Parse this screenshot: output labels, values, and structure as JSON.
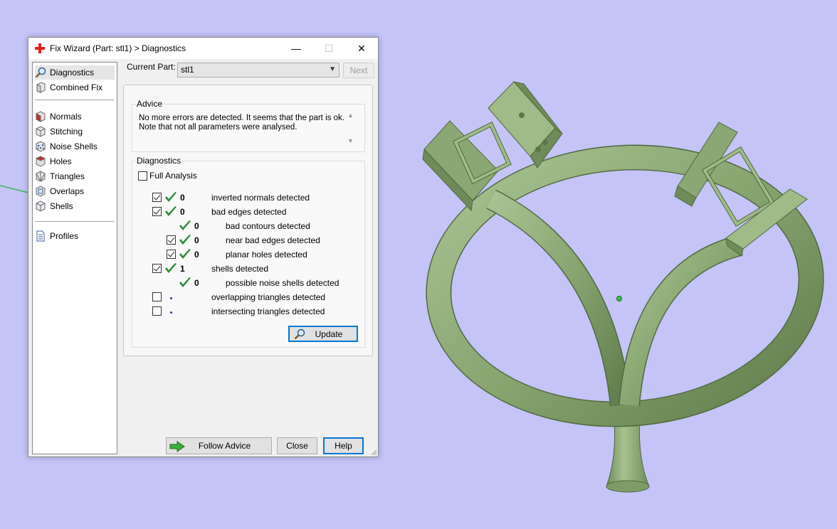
{
  "window": {
    "title": "Fix Wizard (Part: stl1) > Diagnostics",
    "minimize": "—",
    "maximize": "☐",
    "close": "✕"
  },
  "sidebar": {
    "items_top": [
      {
        "label": "Diagnostics",
        "icon": "magnifier-icon",
        "selected": true
      },
      {
        "label": "Combined Fix",
        "icon": "cube-icon"
      }
    ],
    "items_mid": [
      {
        "label": "Normals",
        "icon": "normals-cube-icon"
      },
      {
        "label": "Stitching",
        "icon": "stitching-cube-icon"
      },
      {
        "label": "Noise Shells",
        "icon": "noise-shells-icon"
      },
      {
        "label": "Holes",
        "icon": "holes-cube-icon"
      },
      {
        "label": "Triangles",
        "icon": "triangles-cube-icon"
      },
      {
        "label": "Overlaps",
        "icon": "overlaps-cube-icon"
      },
      {
        "label": "Shells",
        "icon": "shells-cube-icon"
      }
    ],
    "items_bottom": [
      {
        "label": "Profiles",
        "icon": "document-icon"
      }
    ]
  },
  "current_part": {
    "label": "Current Part:",
    "value": "stl1",
    "next_label": "Next"
  },
  "advice": {
    "title": "Advice",
    "line1": "No more errors are detected. It seems that the part is ok.",
    "line2": "Note that not all parameters were analysed."
  },
  "diagnostics": {
    "title": "Diagnostics",
    "full_analysis_label": "Full Analysis",
    "rows": [
      {
        "checkbox": true,
        "checked": true,
        "status": "ok",
        "count": "0",
        "text": "inverted normals detected",
        "indent": 0
      },
      {
        "checkbox": true,
        "checked": true,
        "status": "ok",
        "count": "0",
        "text": "bad edges detected",
        "indent": 0
      },
      {
        "checkbox": false,
        "checked": false,
        "status": "ok",
        "count": "0",
        "text": "bad contours detected",
        "indent": 1
      },
      {
        "checkbox": true,
        "checked": true,
        "status": "ok",
        "count": "0",
        "text": "near bad edges detected",
        "indent": 1
      },
      {
        "checkbox": true,
        "checked": true,
        "status": "ok",
        "count": "0",
        "text": "planar holes detected",
        "indent": 1
      },
      {
        "checkbox": true,
        "checked": true,
        "status": "ok",
        "count": "1",
        "text": "shells detected",
        "indent": 0
      },
      {
        "checkbox": false,
        "checked": false,
        "status": "ok",
        "count": "0",
        "text": "possible noise shells detected",
        "indent": 1
      },
      {
        "checkbox": true,
        "checked": false,
        "status": "none",
        "count": "",
        "text": "overlapping triangles detected",
        "indent": 0
      },
      {
        "checkbox": true,
        "checked": false,
        "status": "none",
        "count": "",
        "text": "intersecting triangles detected",
        "indent": 0
      }
    ],
    "update_label": "Update"
  },
  "footer": {
    "follow_advice_label": "Follow Advice",
    "close_label": "Close",
    "help_label": "Help"
  },
  "colors": {
    "viewport_bg": "#c4c4f7",
    "model_green": "#8fae7a",
    "check_green": "#2e8b3a"
  }
}
